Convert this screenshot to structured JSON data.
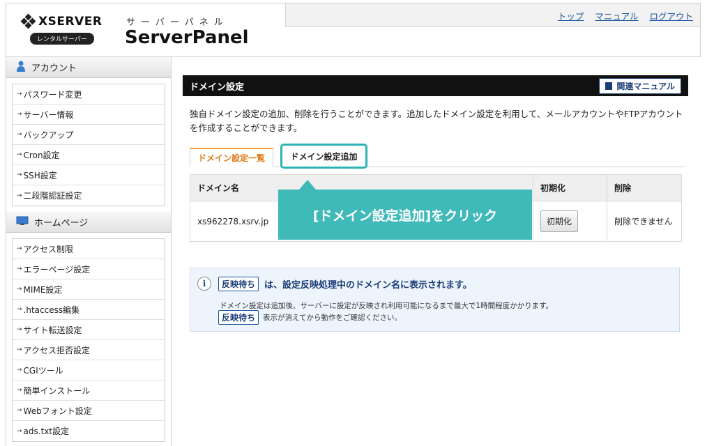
{
  "header": {
    "brand": "XSERVER",
    "rental_badge": "レンタルサーバー",
    "kana": "サーバーパネル",
    "product": "ServerPanel",
    "links": [
      "トップ",
      "マニュアル",
      "ログアウト"
    ]
  },
  "sidebar": {
    "sections": [
      {
        "title": "アカウント",
        "icon": "person-icon",
        "items": [
          "パスワード変更",
          "サーバー情報",
          "バックアップ",
          "Cron設定",
          "SSH設定",
          "二段階認証設定"
        ]
      },
      {
        "title": "ホームページ",
        "icon": "monitor-icon",
        "items": [
          "アクセス制限",
          "エラーページ設定",
          "MIME設定",
          ".htaccess編集",
          "サイト転送設定",
          "アクセス拒否設定",
          "CGIツール",
          "簡単インストール",
          "Webフォント設定",
          "ads.txt設定"
        ]
      }
    ]
  },
  "main": {
    "title": "ドメイン設定",
    "manual_button": "関連マニュアル",
    "description": "独自ドメイン設定の追加、削除を行うことができます。追加したドメイン設定を利用して、メールアカウントやFTPアカウントを作成することができます。",
    "tabs": [
      {
        "label": "ドメイン設定一覧",
        "active": true
      },
      {
        "label": "ドメイン設定追加",
        "active": false
      }
    ],
    "table": {
      "headers": [
        "ドメイン名",
        "初期化",
        "削除"
      ],
      "rows": [
        {
          "domain": "xs962278.xsrv.jp",
          "init_button": "初期化",
          "delete_text": "削除できません"
        }
      ]
    },
    "callout": "[ドメイン設定追加]をクリック",
    "info": {
      "badge": "反映待ち",
      "headline": "は、設定反映処理中のドメイン名に表示されます。",
      "detail": "ドメイン設定は追加後、サーバーに設定が反映され利用可能になるまで最大で1時間程度かかります。",
      "note": "表示が消えてから動作をご確認ください。"
    }
  }
}
